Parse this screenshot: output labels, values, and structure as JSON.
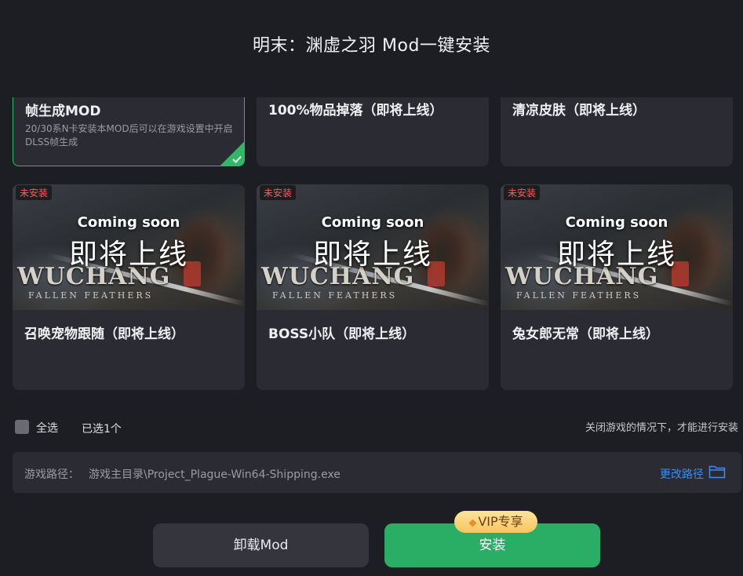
{
  "header": {
    "title": "明末：渊虚之羽 Mod一键安装"
  },
  "mods_top": [
    {
      "name": "帧生成MOD",
      "desc": "20/30系N卡安装本MOD后可以在游戏设置中开启DLSS帧生成",
      "selected": true
    },
    {
      "name": "100%物品掉落（即将上线）",
      "desc": "",
      "selected": false
    },
    {
      "name": "清凉皮肤（即将上线）",
      "desc": "",
      "selected": false
    }
  ],
  "mods_bottom": [
    {
      "name": "召唤宠物跟随（即将上线）",
      "badge": "未安装",
      "banner_en": "Coming soon",
      "banner_cn": "即将上线",
      "logo": "WUCHANG",
      "logo_sub": "FALLEN FEATHERS"
    },
    {
      "name": "BOSS小队（即将上线）",
      "badge": "未安装",
      "banner_en": "Coming soon",
      "banner_cn": "即将上线",
      "logo": "WUCHANG",
      "logo_sub": "FALLEN FEATHERS"
    },
    {
      "name": "兔女郎无常（即将上线）",
      "badge": "未安装",
      "banner_en": "Coming soon",
      "banner_cn": "即将上线",
      "logo": "WUCHANG",
      "logo_sub": "FALLEN FEATHERS"
    }
  ],
  "selection": {
    "select_all_label": "全选",
    "selected_count": "已选1个",
    "hint": "关闭游戏的情况下，才能进行安装"
  },
  "path": {
    "label": "游戏路径：",
    "value": "游戏主目录\\Project_Plague-Win64-Shipping.exe",
    "change_label": "更改路径"
  },
  "actions": {
    "uninstall_label": "卸载Mod",
    "install_label": "安装",
    "vip_label": "VIP专享"
  },
  "colors": {
    "accent_green": "#2aae66",
    "link_blue": "#3d8ee8",
    "badge_red": "#ff5a5a",
    "background": "#1d1e23"
  },
  "icons": {
    "check": "check-icon",
    "folder": "folder-icon",
    "vip_gem": "diamond-icon"
  }
}
